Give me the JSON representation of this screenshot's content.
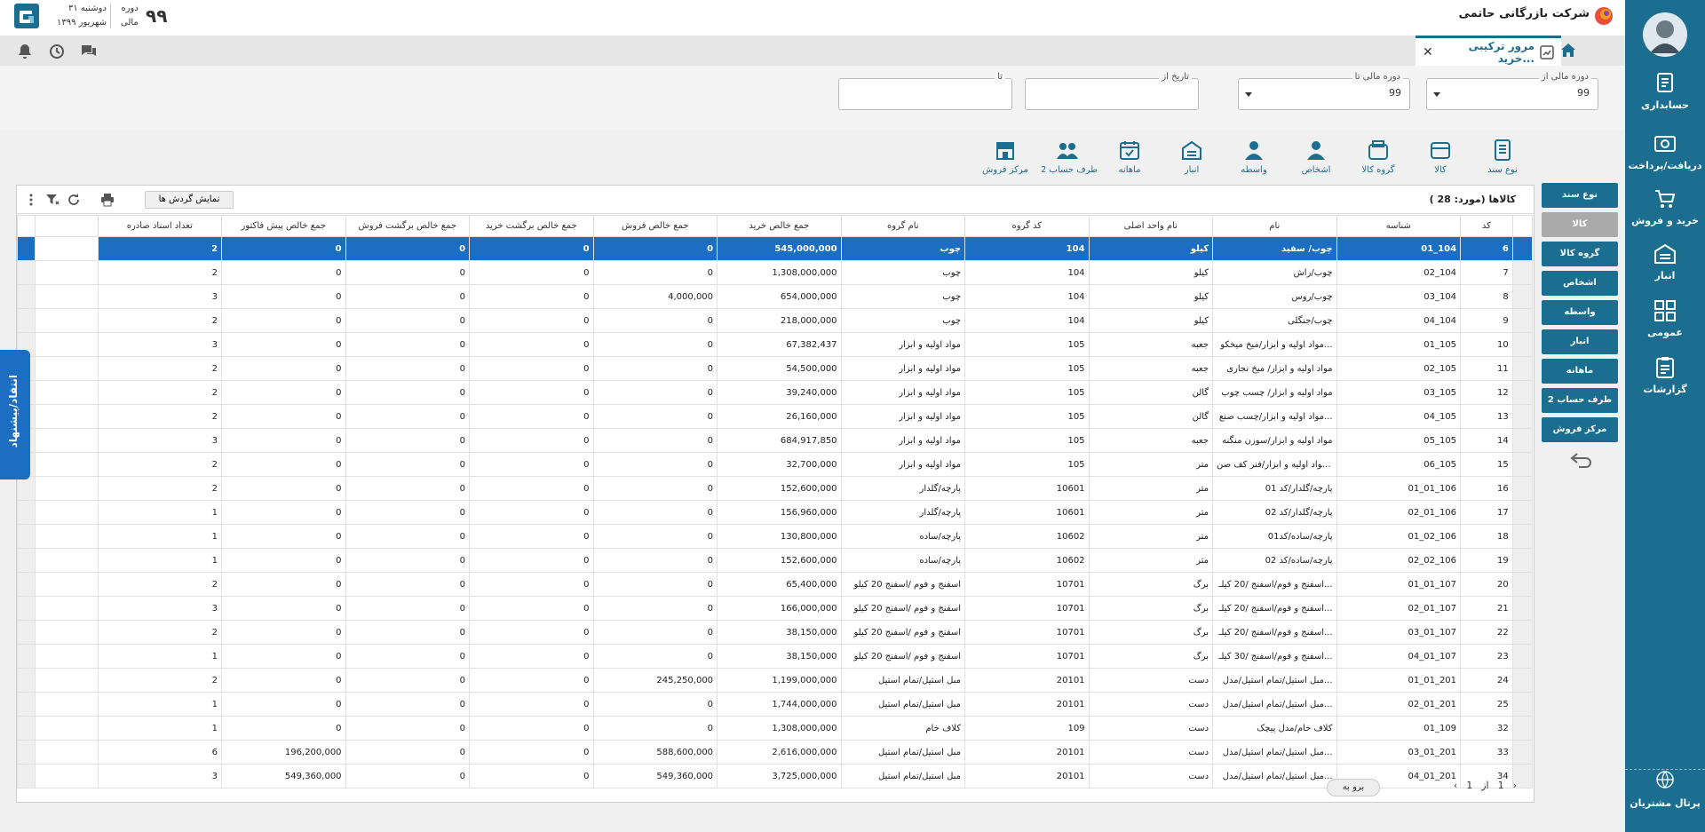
{
  "topbar": {
    "company": "شرکت بازرگانی حاتمی",
    "date_weekday": "دوشنبه ۳۱",
    "date_month": "شهریور ۱۳۹۹",
    "fiscal_label_1": "دوره",
    "fiscal_label_2": "مالی",
    "fiscal_value": "۹۹"
  },
  "sidebar": {
    "items": [
      {
        "label": "حسابداری",
        "icon": "accounting-icon"
      },
      {
        "label": "دریافت/پرداخت",
        "icon": "payment-icon"
      },
      {
        "label": "خرید و فروش",
        "icon": "cart-icon"
      },
      {
        "label": "انبار",
        "icon": "warehouse-icon"
      },
      {
        "label": "عمومی",
        "icon": "general-icon"
      },
      {
        "label": "گزارشات",
        "icon": "reports-icon"
      }
    ],
    "portal": "پرتال مشتریان"
  },
  "tabs": {
    "active": "مرور ترکیبی خرید..."
  },
  "filters": {
    "fiscal_from_label": "دوره مالی از",
    "fiscal_from_value": "99",
    "fiscal_to_label": "دوره مالی تا",
    "fiscal_to_value": "99",
    "date_from_label": "تاریخ از",
    "date_to_label": "تا"
  },
  "group_buttons": [
    {
      "label": "نوع سند",
      "icon": "doc-type-icon"
    },
    {
      "label": "کالا",
      "icon": "goods-icon"
    },
    {
      "label": "گروه کالا",
      "icon": "goods-group-icon"
    },
    {
      "label": "اشخاص",
      "icon": "person-icon"
    },
    {
      "label": "واسطه",
      "icon": "broker-icon"
    },
    {
      "label": "انبار",
      "icon": "warehouse-icon"
    },
    {
      "label": "ماهانه",
      "icon": "calendar-icon"
    },
    {
      "label": "طرف حساب 2",
      "icon": "people-icon"
    },
    {
      "label": "مرکز فروش",
      "icon": "store-icon"
    }
  ],
  "right_buttons": [
    "نوع سند",
    "کالا",
    "گروه کالا",
    "اشخاص",
    "واسطه",
    "انبار",
    "ماهانه",
    "طرف حساب 2",
    "مرکز فروش"
  ],
  "grid": {
    "title": "کالاها (مورد:  28 )",
    "show_turnover": "نمایش گردش ها",
    "columns": [
      "کد",
      "شناسه",
      "نام",
      "نام واحد اصلی",
      "کد گروه",
      "نام گروه",
      "جمع خالص خرید",
      "جمع خالص فروش",
      "جمع خالص برگشت خرید",
      "جمع خالص برگشت فروش",
      "جمع خالص پیش فاکتور",
      "تعداد اسناد صادره"
    ],
    "rows": [
      [
        "6",
        "01_104",
        "چوب/ سفید",
        "کیلو",
        "104",
        "چوب",
        "545,000,000",
        "0",
        "0",
        "0",
        "0",
        "2"
      ],
      [
        "7",
        "02_104",
        "چوب/راش",
        "کیلو",
        "104",
        "چوب",
        "1,308,000,000",
        "0",
        "0",
        "0",
        "0",
        "2"
      ],
      [
        "8",
        "03_104",
        "چوب/روس",
        "کیلو",
        "104",
        "چوب",
        "654,000,000",
        "4,000,000",
        "0",
        "0",
        "0",
        "3"
      ],
      [
        "9",
        "04_104",
        "چوب/جنگلی",
        "کیلو",
        "104",
        "چوب",
        "218,000,000",
        "0",
        "0",
        "0",
        "0",
        "2"
      ],
      [
        "10",
        "01_105",
        "مواد اولیه و ابزار/میخ میخکو...",
        "جعبه",
        "105",
        "مواد اولیه و ابزار",
        "67,382,437",
        "0",
        "0",
        "0",
        "0",
        "3"
      ],
      [
        "11",
        "02_105",
        "مواد اولیه و ابزار/ میخ نجاری",
        "جعبه",
        "105",
        "مواد اولیه و ابزار",
        "54,500,000",
        "0",
        "0",
        "0",
        "0",
        "2"
      ],
      [
        "12",
        "03_105",
        "مواد اولیه و ابزار/ چسب چوب",
        "گالن",
        "105",
        "مواد اولیه و ابزار",
        "39,240,000",
        "0",
        "0",
        "0",
        "0",
        "2"
      ],
      [
        "13",
        "04_105",
        "مواد اولیه و ابزار/چسب صنع...",
        "گالن",
        "105",
        "مواد اولیه و ابزار",
        "26,160,000",
        "0",
        "0",
        "0",
        "0",
        "2"
      ],
      [
        "14",
        "05_105",
        "مواد اولیه و ابزار/سوزن منگنه",
        "جعبه",
        "105",
        "مواد اولیه و ابزار",
        "684,917,850",
        "0",
        "0",
        "0",
        "0",
        "3"
      ],
      [
        "15",
        "06_105",
        "مواد اولیه و ابزار/فنر کف صن...",
        "متر",
        "105",
        "مواد اولیه و ابزار",
        "32,700,000",
        "0",
        "0",
        "0",
        "0",
        "2"
      ],
      [
        "16",
        "01_01_106",
        "پارچه/گلدار/کد 01",
        "متر",
        "10601",
        "پارچه/گلدار",
        "152,600,000",
        "0",
        "0",
        "0",
        "0",
        "2"
      ],
      [
        "17",
        "02_01_106",
        "پارچه/گلدار/کد 02",
        "متر",
        "10601",
        "پارچه/گلدار",
        "156,960,000",
        "0",
        "0",
        "0",
        "0",
        "1"
      ],
      [
        "18",
        "01_02_106",
        "پارچه/ساده/کد01",
        "متر",
        "10602",
        "پارچه/ساده",
        "130,800,000",
        "0",
        "0",
        "0",
        "0",
        "1"
      ],
      [
        "19",
        "02_02_106",
        "پارچه/ساده/کد 02",
        "متر",
        "10602",
        "پارچه/ساده",
        "152,600,000",
        "0",
        "0",
        "0",
        "0",
        "1"
      ],
      [
        "20",
        "01_01_107",
        "اسفنج و فوم/اسفنج /20 کیلـ...",
        "برگ",
        "10701",
        "اسفنج و فوم /اسفنج 20 کیلو",
        "65,400,000",
        "0",
        "0",
        "0",
        "0",
        "2"
      ],
      [
        "21",
        "02_01_107",
        "اسفنج و فوم/اسفنج /20 کیلـ...",
        "برگ",
        "10701",
        "اسفنج و فوم /اسفنج 20 کیلو",
        "166,000,000",
        "0",
        "0",
        "0",
        "0",
        "3"
      ],
      [
        "22",
        "03_01_107",
        "اسفنج و فوم/اسفنج /20 کیلـ...",
        "برگ",
        "10701",
        "اسفنج و فوم /اسفنج 20 کیلو",
        "38,150,000",
        "0",
        "0",
        "0",
        "0",
        "2"
      ],
      [
        "23",
        "04_01_107",
        "اسفنج و فوم/اسفنج /30 کیلـ...",
        "برگ",
        "10701",
        "اسفنج و فوم /اسفنج 20 کیلو",
        "38,150,000",
        "0",
        "0",
        "0",
        "0",
        "1"
      ],
      [
        "24",
        "01_01_201",
        "مبل استیل/تمام استیل/مدل...",
        "دست",
        "20101",
        "مبل استیل/تمام استیل",
        "1,199,000,000",
        "245,250,000",
        "0",
        "0",
        "0",
        "2"
      ],
      [
        "25",
        "02_01_201",
        "مبل استیل/تمام استیل/مدل...",
        "دست",
        "20101",
        "مبل استیل/تمام استیل",
        "1,744,000,000",
        "0",
        "0",
        "0",
        "0",
        "1"
      ],
      [
        "32",
        "01_109",
        "کلاف خام/مدل پیچک",
        "دست",
        "109",
        "کلاف خام",
        "1,308,000,000",
        "0",
        "0",
        "0",
        "0",
        "1"
      ],
      [
        "33",
        "03_01_201",
        "مبل استیل/تمام استیل/مدل...",
        "دست",
        "20101",
        "مبل استیل/تمام استیل",
        "2,616,000,000",
        "588,600,000",
        "0",
        "0",
        "196,200,000",
        "6"
      ],
      [
        "34",
        "04_01_201",
        "مبل استیل/تمام استیل/مدل...",
        "دست",
        "20101",
        "مبل استیل/تمام استیل",
        "3,725,000,000",
        "549,360,000",
        "0",
        "0",
        "549,360,000",
        "3"
      ]
    ]
  },
  "pager": {
    "page": "1",
    "of": "از",
    "total": "1",
    "goto": "برو به"
  },
  "feedback": "انتقاد/پیشنهاد"
}
